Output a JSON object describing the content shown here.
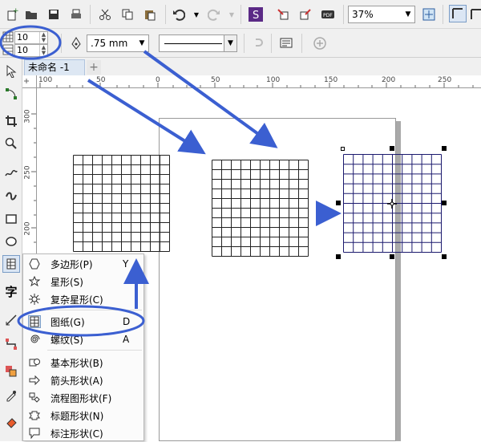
{
  "toolbar": {
    "zoom_value": "37%",
    "icons": [
      "new-icon",
      "open-icon",
      "save-icon",
      "print-icon",
      "cut-icon",
      "copy-icon",
      "paste-icon",
      "undo-icon",
      "redo-icon",
      "corel-connect-icon",
      "import-icon",
      "export-icon",
      "publish-pdf-icon",
      "zoom-combo",
      "full-screen-icon",
      "snap-icon"
    ]
  },
  "property_bar": {
    "columns_value": "10",
    "rows_value": "10",
    "outline_width_value": ".75 mm"
  },
  "document": {
    "tab_label": "未命名 -1",
    "add_tab_label": "+"
  },
  "ruler": {
    "h_labels": [
      "100",
      "50",
      "0",
      "50",
      "100",
      "150",
      "200",
      "250"
    ],
    "v_labels": [
      "300",
      "250",
      "200"
    ]
  },
  "flyout_menu": {
    "items": [
      {
        "label": "多边形(P)",
        "shortcut": "Y",
        "icon": "polygon-icon"
      },
      {
        "label": "星形(S)",
        "shortcut": "",
        "icon": "star-icon"
      },
      {
        "label": "复杂星形(C)",
        "shortcut": "",
        "icon": "complex-star-icon"
      },
      {
        "label": "图纸(G)",
        "shortcut": "D",
        "icon": "graph-paper-icon"
      },
      {
        "label": "螺纹(S)",
        "shortcut": "A",
        "icon": "spiral-icon"
      },
      {
        "label": "基本形状(B)",
        "shortcut": "",
        "icon": "basic-shapes-icon"
      },
      {
        "label": "箭头形状(A)",
        "shortcut": "",
        "icon": "arrow-shapes-icon"
      },
      {
        "label": "流程图形状(F)",
        "shortcut": "",
        "icon": "flowchart-shapes-icon"
      },
      {
        "label": "标题形状(N)",
        "shortcut": "",
        "icon": "banner-shapes-icon"
      },
      {
        "label": "标注形状(C)",
        "shortcut": "",
        "icon": "callout-shapes-icon"
      }
    ]
  },
  "colors": {
    "annotation_blue": "#3b5fd1",
    "selected_grid": "#1c1a6e",
    "tab_bg": "#dde7f3"
  }
}
